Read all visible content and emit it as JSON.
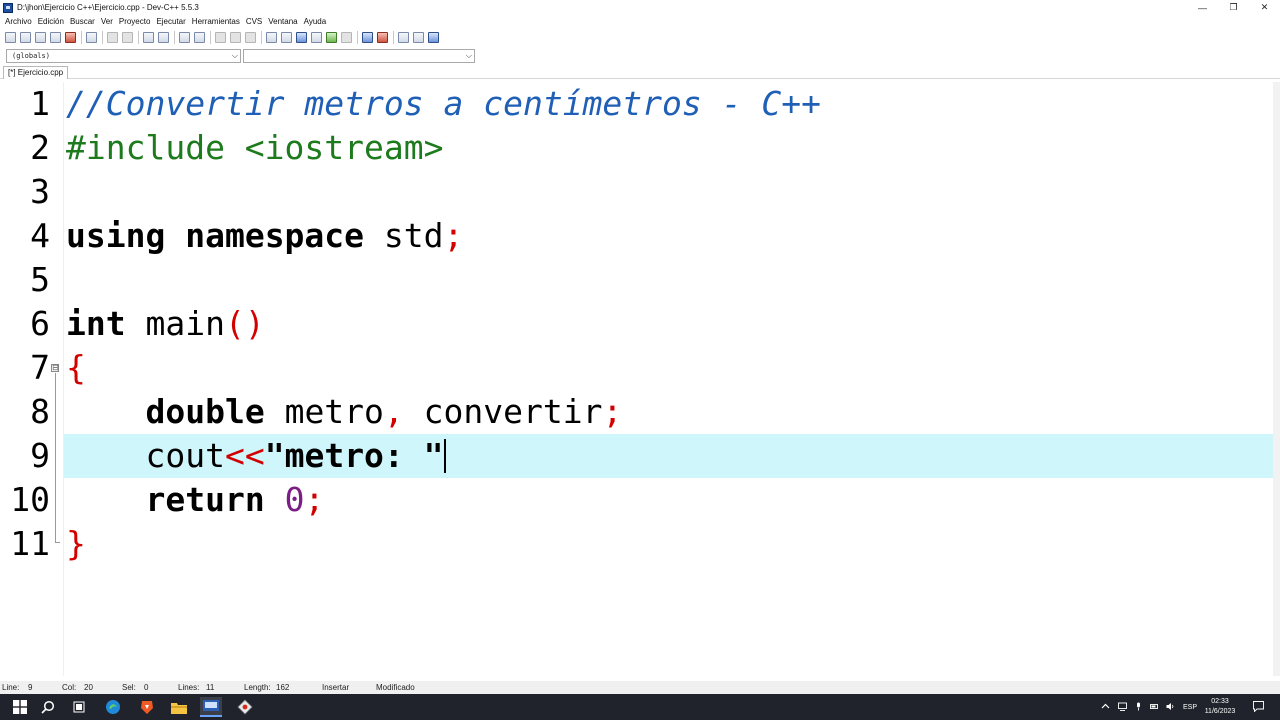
{
  "window": {
    "title": "D:\\jhon\\Ejercicio C++\\Ejercicio.cpp - Dev-C++ 5.5.3",
    "minimize": "—",
    "maximize": "❐",
    "close": "✕"
  },
  "menu": [
    "Archivo",
    "Edición",
    "Buscar",
    "Ver",
    "Proyecto",
    "Ejecutar",
    "Herramientas",
    "CVS",
    "Ventana",
    "Ayuda"
  ],
  "selectors": {
    "scope": "(globals)",
    "symbol": ""
  },
  "tab": {
    "label": "[*] Ejercicio.cpp"
  },
  "editor": {
    "line_numbers": [
      "1",
      "2",
      "3",
      "4",
      "5",
      "6",
      "7",
      "8",
      "9",
      "10",
      "11"
    ],
    "line1": "//Convertir metros a centímetros - C++",
    "line2": "#include <iostream>",
    "line4_kw1": "using",
    "line4_kw2": "namespace",
    "line4_id": " std",
    "line4_sym": ";",
    "line6_kw": "int",
    "line6_id": " main",
    "line6_sym": "()",
    "line7_sym": "{",
    "line8_kw": "double",
    "line8_id1": " metro",
    "line8_sym1": ",",
    "line8_id2": " convertir",
    "line8_sym2": ";",
    "line9_id": "cout",
    "line9_sym": "<<",
    "line9_str": "\"metro: \"",
    "line10_kw": "return",
    "line10_num": "0",
    "line10_sym": ";",
    "line11_sym": "}",
    "fold_glyph": "⊟"
  },
  "status": {
    "line_label": "Line:",
    "line_value": "9",
    "col_label": "Col:",
    "col_value": "20",
    "sel_label": "Sel:",
    "sel_value": "0",
    "lines_label": "Lines:",
    "lines_value": "11",
    "length_label": "Length:",
    "length_value": "162",
    "mode": "Insertar",
    "modified": "Modificado"
  },
  "taskbar": {
    "language": "ESP",
    "time": "02:33",
    "date": "11/6/2023"
  },
  "colors": {
    "comment": "#1f5fb5",
    "preprocessor": "#1d7a1d",
    "symbol": "#d40000",
    "number": "#7a1d84",
    "active_line": "#cff6fb"
  }
}
